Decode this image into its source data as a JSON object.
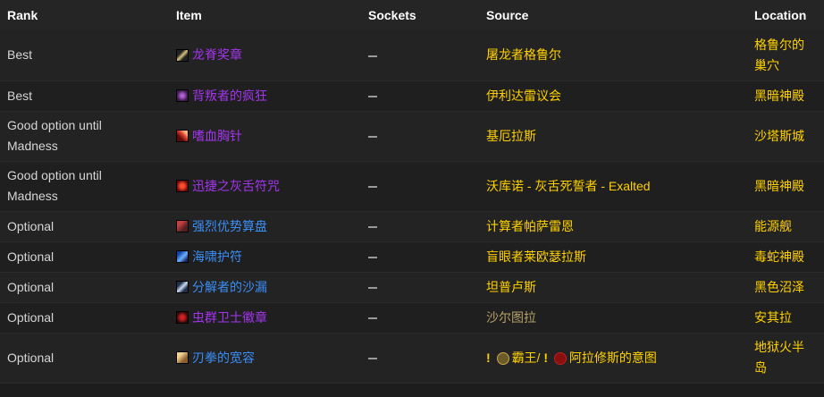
{
  "headers": {
    "rank": "Rank",
    "item": "Item",
    "sockets": "Sockets",
    "source": "Source",
    "location": "Location"
  },
  "rows": [
    {
      "rank": "Best",
      "item": "龙脊奖章",
      "item_quality": "epic",
      "icon": "dagger-trinket-icon",
      "source": "屠龙者格鲁尔",
      "location": "格鲁尔的巢穴"
    },
    {
      "rank": "Best",
      "item": "背叛者的疯狂",
      "item_quality": "epic",
      "icon": "demon-face-trinket-icon",
      "source": "伊利达雷议会",
      "location": "黑暗神殿"
    },
    {
      "rank": "Good option until Madness",
      "item": "嗜血胸针",
      "item_quality": "epic",
      "icon": "red-blade-trinket-icon",
      "source": "基厄拉斯",
      "location": "沙塔斯城"
    },
    {
      "rank": "Good option until Madness",
      "item": "迅捷之灰舌符咒",
      "item_quality": "epic",
      "icon": "red-talisman-icon",
      "source": "沃库诺 - 灰舌死誓者 - Exalted",
      "location": "黑暗神殿"
    },
    {
      "rank": "Optional",
      "item": "强烈优势算盘",
      "item_quality": "rare",
      "icon": "abacus-icon",
      "source": "计算者帕萨雷恩",
      "location": "能源舰"
    },
    {
      "rank": "Optional",
      "item": "海啸护符",
      "item_quality": "rare",
      "icon": "tsunami-icon",
      "source": "盲眼者莱欧瑟拉斯",
      "location": "毒蛇神殿"
    },
    {
      "rank": "Optional",
      "item": "分解者的沙漏",
      "item_quality": "rare",
      "icon": "hourglass-icon",
      "source": "坦普卢斯",
      "location": "黑色沼泽"
    },
    {
      "rank": "Optional",
      "item": "虫群卫士徽章",
      "item_quality": "epic",
      "icon": "insect-badge-icon",
      "source": "沙尔图拉",
      "location": "安其拉"
    },
    {
      "rank": "Optional",
      "item": "刃拳的宽容",
      "item_quality": "rare",
      "icon": "fist-icon",
      "source_prefix": "!",
      "source_mid": "霸王/",
      "source_prefix2": "!",
      "source_suffix": "阿拉修斯的意图",
      "location": "地狱火半岛"
    }
  ],
  "colors": {
    "epic": "#a335ee",
    "rare": "#3b8ef5",
    "gold": "#ffd100",
    "background": "#1d1d1d"
  }
}
